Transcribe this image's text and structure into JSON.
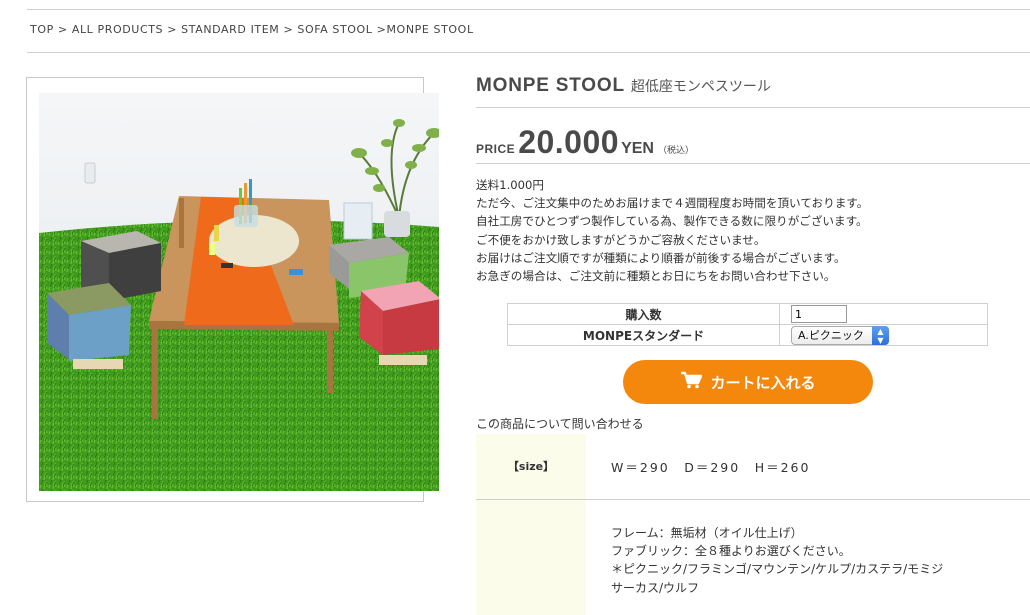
{
  "breadcrumb": {
    "top": "TOP",
    "sep1": " > ",
    "all_products": "ALL PRODUCTS",
    "sep2": " > ",
    "standard_item": "STANDARD ITEM",
    "sep3": " > ",
    "sofa_stool": "SOFA STOOL",
    "sep4": " >",
    "current": "MONPE STOOL"
  },
  "product": {
    "name_en": "MONPE STOOL",
    "name_jp": "超低座モンペスツール",
    "price_label": "PRICE",
    "price_value": "20.000",
    "price_unit": "YEN",
    "price_tax": "（税込）",
    "photo_icon": "product-photo"
  },
  "description": {
    "lines": [
      "送料1.000円",
      "ただ今、ご注文集中のためお届けまで４週間程度お時間を頂いております。",
      "自社工房でひとつずつ製作している為、製作できる数に限りがございます。",
      "ご不便をおかけ致しますがどうかご容赦くださいませ。",
      "お届けはご注文順ですが種類により順番が前後する場合がございます。",
      "お急ぎの場合は、ご注文前に種類とお日にちをお問い合わせ下さい。"
    ]
  },
  "options": {
    "quantity_label": "購入数",
    "quantity_value": "1",
    "variant_label": "MONPEスタンダード",
    "variant_selected": "A.ピクニック"
  },
  "cart": {
    "button_label": "カートに入れる",
    "icon": "cart-icon",
    "color": "#f3880c"
  },
  "inquiry_label": "この商品について問い合わせる",
  "spec": {
    "size_label": "【size】",
    "size_value": "W＝290　D＝290　H＝260",
    "material_lines": [
      "フレーム：無垢材（オイル仕上げ）",
      "ファブリック：全８種よりお選びください。",
      "＊ピクニック/フラミンゴ/マウンテン/ケルプ/カステラ/モミジ",
      "サーカス/ウルフ"
    ]
  },
  "colors": {
    "accent": "#f3880c",
    "spec_bg": "#fbfce9",
    "rule": "#cfcfcf"
  }
}
